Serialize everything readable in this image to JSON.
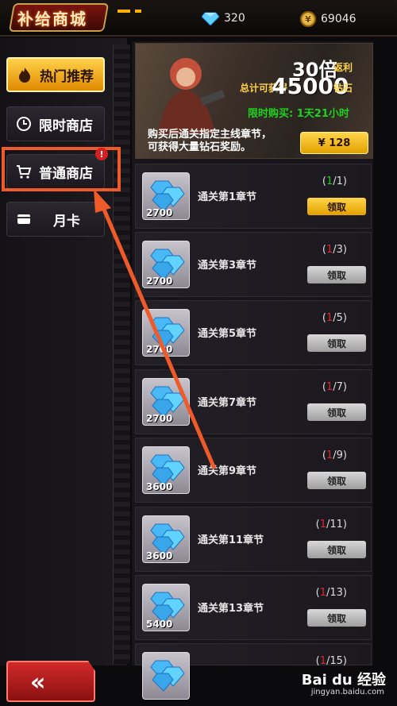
{
  "header": {
    "title": "补给商城",
    "diamonds": "320",
    "gold": "69046"
  },
  "sidebar": {
    "items": [
      {
        "label": "热门推荐",
        "icon": "flame-icon"
      },
      {
        "label": "限时商店",
        "icon": "clock-icon"
      },
      {
        "label": "普通商店",
        "icon": "cart-icon"
      },
      {
        "label": "月卡",
        "icon": "card-icon"
      }
    ],
    "badge": "!"
  },
  "banner": {
    "multiplier": "30倍",
    "multiplier_sub": "返利",
    "total_label": "总计可获得",
    "total_value": "45000",
    "total_unit": "钻石",
    "timer": "限时购买: 1天21小时",
    "desc_line1": "购买后通关指定主线章节，",
    "desc_line2": "可获得大量钻石奖励。",
    "price": "¥ 128"
  },
  "rewards": [
    {
      "label": "通关第1章节",
      "count": "2700",
      "got": "1",
      "total": "/1)",
      "claim": "领取",
      "claimable": true
    },
    {
      "label": "通关第3章节",
      "count": "2700",
      "got": "1",
      "total": "/3)",
      "claim": "领取",
      "claimable": false
    },
    {
      "label": "通关第5章节",
      "count": "2700",
      "got": "1",
      "total": "/5)",
      "claim": "领取",
      "claimable": false
    },
    {
      "label": "通关第7章节",
      "count": "2700",
      "got": "1",
      "total": "/7)",
      "claim": "领取",
      "claimable": false
    },
    {
      "label": "通关第9章节",
      "count": "3600",
      "got": "1",
      "total": "/9)",
      "claim": "领取",
      "claimable": false
    },
    {
      "label": "通关第11章节",
      "count": "3600",
      "got": "1",
      "total": "/11)",
      "claim": "领取",
      "claimable": false
    },
    {
      "label": "通关第13章节",
      "count": "5400",
      "got": "1",
      "total": "/13)",
      "claim": "领取",
      "claimable": false
    },
    {
      "label": "",
      "count": "",
      "got": "1",
      "total": "/15)",
      "claim": "",
      "claimable": false
    }
  ],
  "back_button": "«",
  "watermark": {
    "brand": "Bai du 经验",
    "url": "jingyan.baidu.com"
  },
  "colors": {
    "accent_gold": "#ffd24a",
    "alert_red": "#e02828",
    "complete_green": "#22c922",
    "highlight_orange": "#ef5a2a"
  }
}
